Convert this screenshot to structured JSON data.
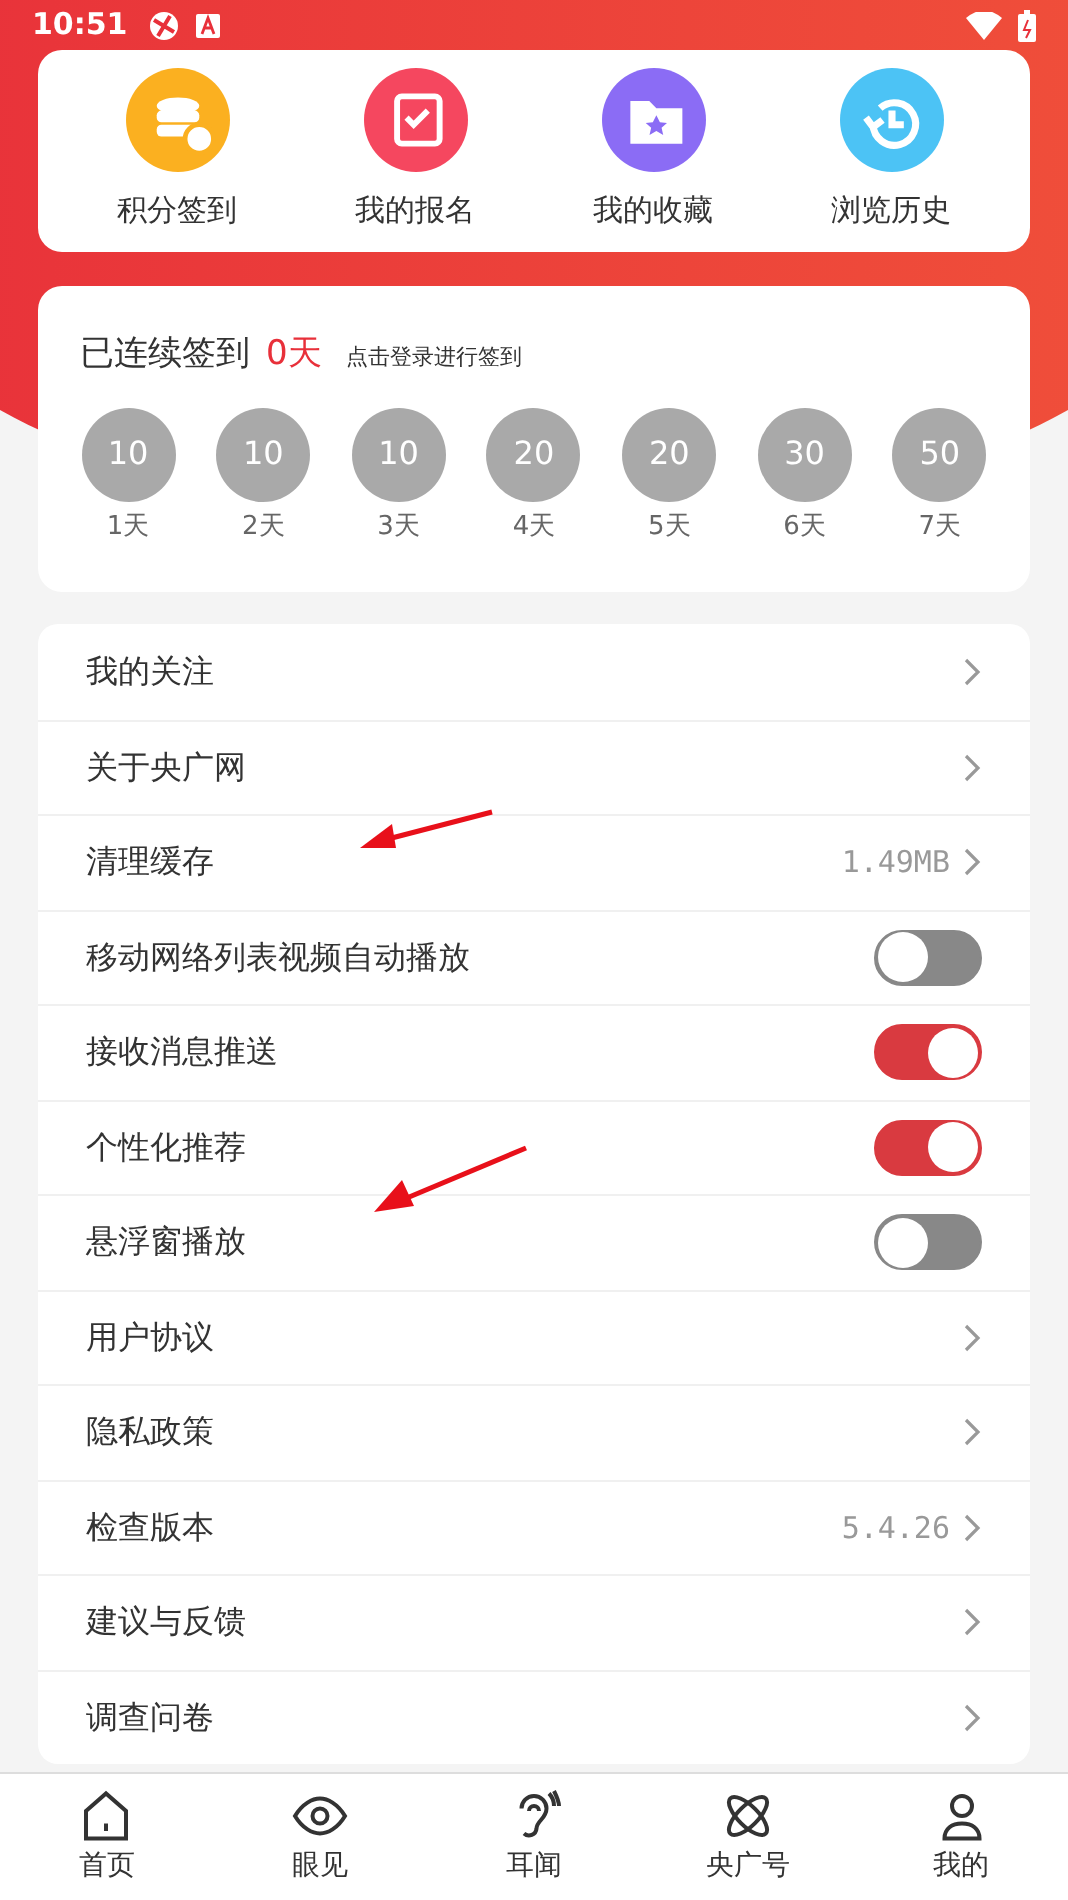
{
  "status_bar": {
    "time": "10:51"
  },
  "shortcuts": [
    {
      "label": "积分签到",
      "color": "#fbb020"
    },
    {
      "label": "我的报名",
      "color": "#f5475f"
    },
    {
      "label": "我的收藏",
      "color": "#8b6cf5"
    },
    {
      "label": "浏览历史",
      "color": "#4cc3f5"
    }
  ],
  "checkin": {
    "title": "已连续签到",
    "days": "0天",
    "hint": "点击登录进行签到",
    "rewards": [
      {
        "points": "10",
        "day": "1天"
      },
      {
        "points": "10",
        "day": "2天"
      },
      {
        "points": "10",
        "day": "3天"
      },
      {
        "points": "20",
        "day": "4天"
      },
      {
        "points": "20",
        "day": "5天"
      },
      {
        "points": "30",
        "day": "6天"
      },
      {
        "points": "50",
        "day": "7天"
      }
    ]
  },
  "settings": [
    {
      "kind": "link",
      "label": "我的关注"
    },
    {
      "kind": "link",
      "label": "关于央广网"
    },
    {
      "kind": "link",
      "label": "清理缓存",
      "value": "1.49MB"
    },
    {
      "kind": "toggle",
      "label": "移动网络列表视频自动播放",
      "on": false
    },
    {
      "kind": "toggle",
      "label": "接收消息推送",
      "on": true
    },
    {
      "kind": "toggle",
      "label": "个性化推荐",
      "on": true
    },
    {
      "kind": "toggle",
      "label": "悬浮窗播放",
      "on": false
    },
    {
      "kind": "link",
      "label": "用户协议"
    },
    {
      "kind": "link",
      "label": "隐私政策"
    },
    {
      "kind": "link",
      "label": "检查版本",
      "value": "5.4.26"
    },
    {
      "kind": "link",
      "label": "建议与反馈"
    },
    {
      "kind": "link",
      "label": "调查问卷"
    }
  ],
  "bottom_nav": [
    {
      "label": "首页"
    },
    {
      "label": "眼见"
    },
    {
      "label": "耳闻"
    },
    {
      "label": "央广号"
    },
    {
      "label": "我的"
    }
  ]
}
